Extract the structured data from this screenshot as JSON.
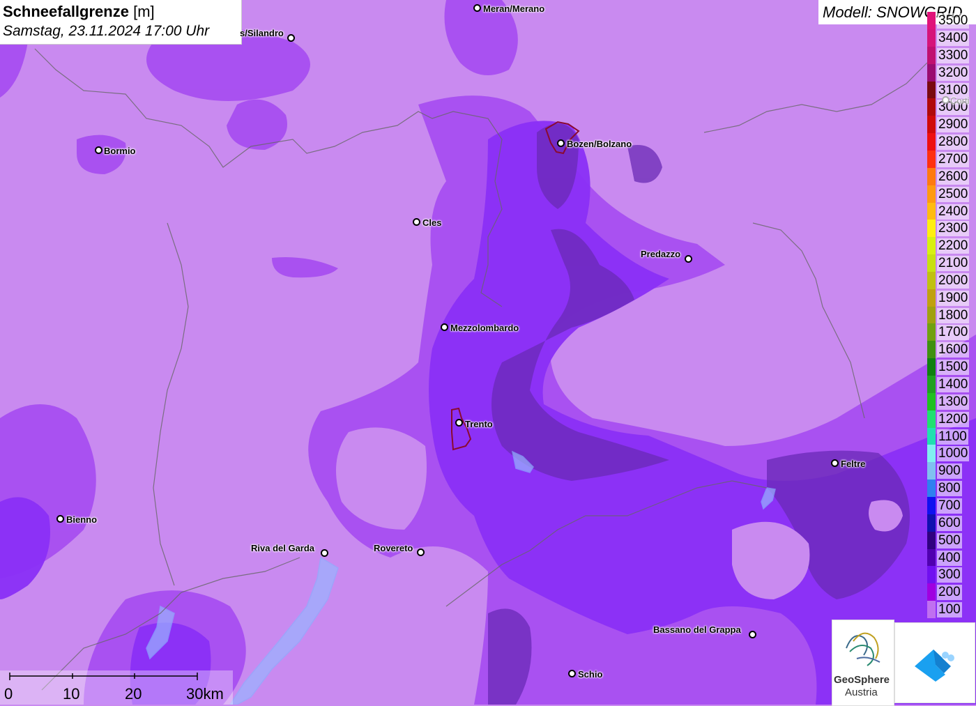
{
  "title": {
    "main": "Schneefallgrenze",
    "unit": "[m]",
    "datetime": "Samstag, 23.11.2024 17:00 Uhr"
  },
  "model": "Modell: SNOWGRID",
  "legend": {
    "top_partial": "3500",
    "levels": [
      {
        "value": "3400",
        "color": "#d6147a"
      },
      {
        "value": "3300",
        "color": "#c01070"
      },
      {
        "value": "3200",
        "color": "#9a0c70"
      },
      {
        "value": "3100",
        "color": "#7a0a10"
      },
      {
        "value": "3000",
        "color": "#b00a0a"
      },
      {
        "value": "2900",
        "color": "#d00a0a"
      },
      {
        "value": "2800",
        "color": "#ee1010"
      },
      {
        "value": "2700",
        "color": "#ff3010"
      },
      {
        "value": "2600",
        "color": "#ff7a10"
      },
      {
        "value": "2500",
        "color": "#ff9a10"
      },
      {
        "value": "2400",
        "color": "#ffbb10"
      },
      {
        "value": "2300",
        "color": "#ffee10"
      },
      {
        "value": "2200",
        "color": "#d8f010"
      },
      {
        "value": "2100",
        "color": "#c8e010"
      },
      {
        "value": "2000",
        "color": "#c0c010"
      },
      {
        "value": "1900",
        "color": "#c0a010"
      },
      {
        "value": "1800",
        "color": "#a0a010"
      },
      {
        "value": "1700",
        "color": "#70a010"
      },
      {
        "value": "1600",
        "color": "#409010"
      },
      {
        "value": "1500",
        "color": "#108010"
      },
      {
        "value": "1400",
        "color": "#20a020"
      },
      {
        "value": "1300",
        "color": "#20c020"
      },
      {
        "value": "1200",
        "color": "#20e070"
      },
      {
        "value": "1100",
        "color": "#20e0b0"
      },
      {
        "value": "1000",
        "color": "#80f0f0"
      },
      {
        "value": "900",
        "color": "#80c0f0"
      },
      {
        "value": "800",
        "color": "#3080f0"
      },
      {
        "value": "700",
        "color": "#1010f0"
      },
      {
        "value": "600",
        "color": "#1010b0"
      },
      {
        "value": "500",
        "color": "#300080"
      },
      {
        "value": "400",
        "color": "#5000b0"
      },
      {
        "value": "300",
        "color": "#7010f0"
      },
      {
        "value": "200",
        "color": "#a000e0"
      },
      {
        "value": "100",
        "color": "#c070f0"
      }
    ]
  },
  "cities": [
    {
      "name": "Meran/Merano",
      "dot": [
        684,
        11
      ],
      "label": [
        693,
        5
      ]
    },
    {
      "name": "s/Silandro",
      "dot": [
        417,
        54
      ],
      "label": [
        344,
        40
      ]
    },
    {
      "name": "Bormio",
      "dot": [
        141,
        215
      ],
      "label": [
        149,
        209
      ]
    },
    {
      "name": "Bozen/Bolzano",
      "dot": [
        804,
        205
      ],
      "label": [
        813,
        199
      ]
    },
    {
      "name": "Cles",
      "dot": [
        597,
        318
      ],
      "label": [
        606,
        312
      ]
    },
    {
      "name": "Predazzo",
      "dot": [
        987,
        371
      ],
      "label": [
        919,
        357
      ]
    },
    {
      "name": "Mezzolombardo",
      "dot": [
        637,
        469
      ],
      "label": [
        646,
        463
      ]
    },
    {
      "name": "Trento",
      "dot": [
        658,
        606
      ],
      "label": [
        667,
        601
      ]
    },
    {
      "name": "Feltre",
      "dot": [
        1197,
        664
      ],
      "label": [
        1206,
        658
      ]
    },
    {
      "name": "Bienno",
      "dot": [
        86,
        744
      ],
      "label": [
        95,
        738
      ]
    },
    {
      "name": "Riva del Garda",
      "dot": [
        465,
        793
      ],
      "label": [
        360,
        779
      ]
    },
    {
      "name": "Rovereto",
      "dot": [
        603,
        792
      ],
      "label": [
        536,
        779
      ]
    },
    {
      "name": "Bassano del Grappa",
      "dot": [
        1079,
        910
      ],
      "label": [
        937,
        896
      ]
    },
    {
      "name": "Schio",
      "dot": [
        820,
        966
      ],
      "label": [
        829,
        960
      ]
    },
    {
      "name": "Corti",
      "dot": [
        1356,
        143
      ],
      "label": [
        1363,
        137
      ]
    }
  ],
  "scale": {
    "labels": [
      "0",
      "10",
      "20",
      "30km"
    ]
  },
  "logos": {
    "geosphere_line1": "GeoSphere",
    "geosphere_line2": "Austria"
  },
  "icons": {
    "geosphere": "geosphere-logo-icon",
    "partner": "blue-cloud-arrow-icon"
  }
}
